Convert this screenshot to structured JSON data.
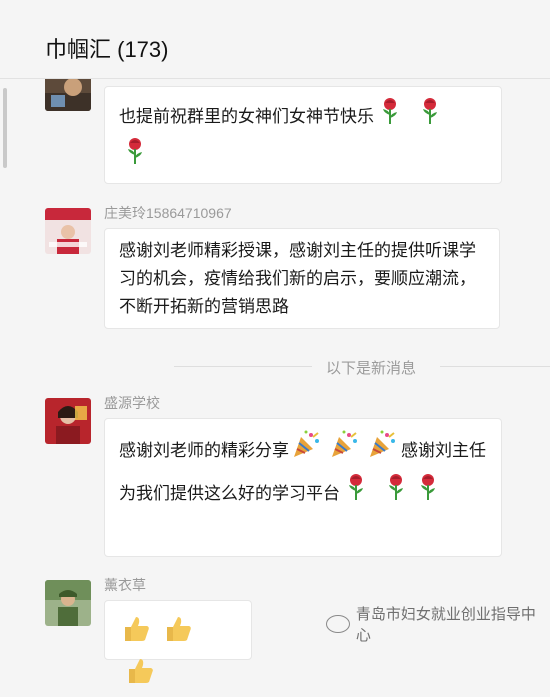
{
  "window": {
    "title": "巾帼汇 (173)"
  },
  "messages": [
    {
      "sender": "",
      "text": "也提前祝群里的女神们女神节快乐",
      "emojis": [
        "rose-emoji",
        "rose-emoji",
        "rose-emoji"
      ]
    },
    {
      "sender": "庄美玲15864710967",
      "text": "感谢刘老师精彩授课，感谢刘主任的提供听课学习的机会，疫情给我们新的启示，要顺应潮流，不断开拓新的营销思路"
    },
    {
      "sender": "盛源学校",
      "text_part1": "感谢刘老师的精彩分享",
      "text_part2": "感谢刘主任为我们提供这么好的学习平台",
      "emojis": [
        "party-popper-emoji",
        "party-popper-emoji",
        "party-popper-emoji",
        "rose-emoji",
        "rose-emoji",
        "rose-emoji"
      ]
    },
    {
      "sender": "薰衣草",
      "emojis": [
        "thumbs-up-emoji",
        "thumbs-up-emoji",
        "thumbs-up-emoji"
      ]
    }
  ],
  "divider": {
    "text": "以下是新消息"
  },
  "watermark": {
    "text": "青岛市妇女就业创业指导中心"
  },
  "colors": {
    "background": "#f5f5f5",
    "bubble": "#ffffff",
    "meta_text": "#9a9a9a",
    "rose": "#d42b3a",
    "leaf": "#3a9a3a"
  }
}
